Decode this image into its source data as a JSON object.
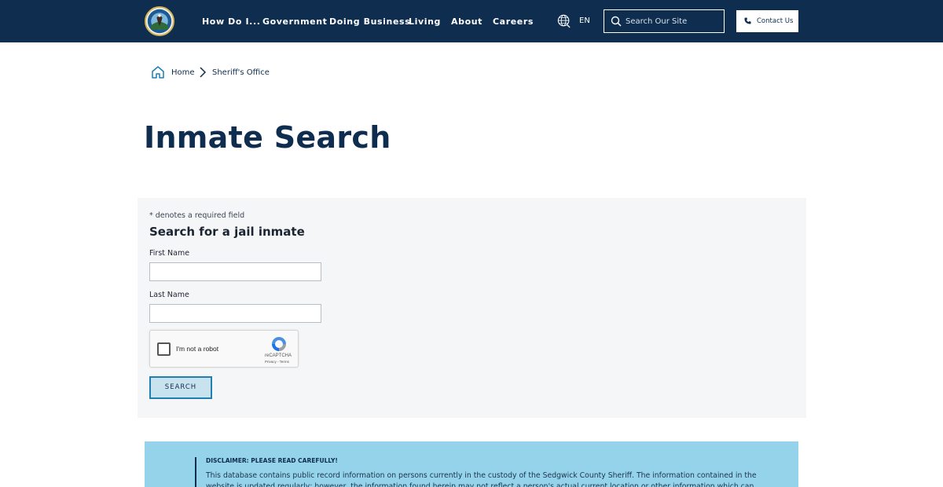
{
  "header": {
    "nav": [
      {
        "label": "How Do I..."
      },
      {
        "label": "Government"
      },
      {
        "label": "Doing Business"
      },
      {
        "label": "Living"
      },
      {
        "label": "About"
      },
      {
        "label": "Careers"
      }
    ],
    "language": "EN",
    "search_placeholder": "Search Our Site",
    "contact_label": "Contact Us"
  },
  "breadcrumb": {
    "home": "Home",
    "current": "Sheriff's Office"
  },
  "page": {
    "title": "Inmate Search"
  },
  "form": {
    "required_note": "* denotes a required field",
    "title": "Search for a jail inmate",
    "first_name_label": "First Name",
    "first_name_value": "",
    "last_name_label": "Last Name",
    "last_name_value": "",
    "captcha_text": "I'm not a robot",
    "captcha_brand": "reCAPTCHA",
    "captcha_links": "Privacy - Terms",
    "search_button": "SEARCH"
  },
  "disclaimer": {
    "title": "DISCLAIMER: PLEASE READ CAREFULLY!",
    "text": "This database contains public record information on persons currently in the custody of the Sedgwick County Sheriff. The information contained in the website is updated regularly; however, the information found herein may not reflect a person's actual current location or other information which can change rapidly."
  },
  "colors": {
    "header_bg": "#0e2d4f",
    "panel_bg": "#f5f6f8",
    "disclaimer_bg": "#94d3e9",
    "button_bg": "#c9e3ee",
    "button_border": "#1f7fb3"
  }
}
